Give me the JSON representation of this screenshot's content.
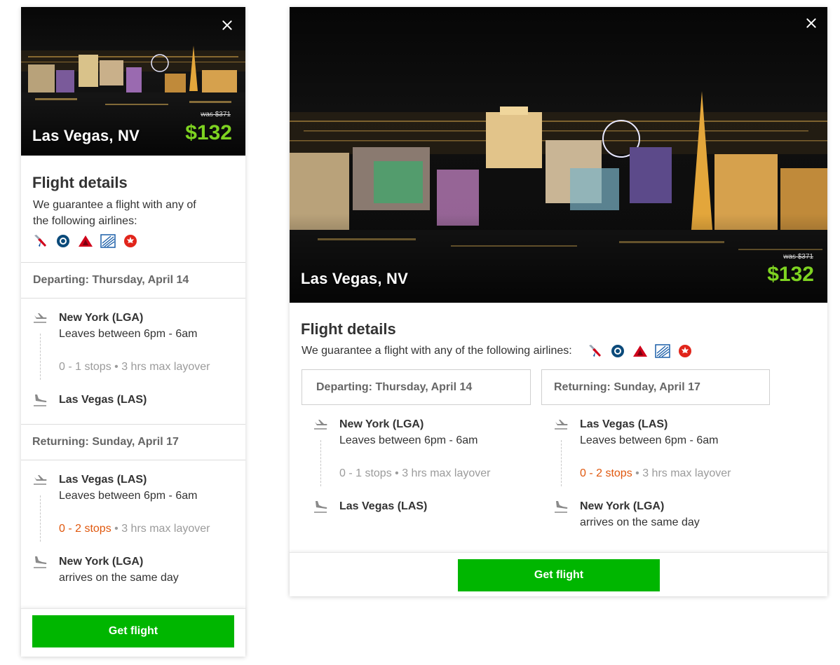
{
  "trip": {
    "city": "Las Vegas, NV",
    "was_price": "was $371",
    "price": "$132"
  },
  "details": {
    "title": "Flight details",
    "guarantee": "We guarantee a flight with any of the following airlines:",
    "airlines": [
      "american-airlines-icon",
      "alaska-airlines-icon",
      "delta-icon",
      "united-icon",
      "air-canada-icon"
    ]
  },
  "departing": {
    "header": "Departing: Thursday, April 14",
    "from": "New York (LGA)",
    "leaves": "Leaves between 6pm - 6am",
    "stops": "0 - 1 stops",
    "stops_highlighted": false,
    "layover": "• 3 hrs max layover",
    "to": "Las Vegas (LAS)",
    "arrives": ""
  },
  "returning": {
    "header": "Returning: Sunday, April 17",
    "from": "Las Vegas (LAS)",
    "leaves": "Leaves between 6pm - 6am",
    "stops": "0 - 2 stops",
    "stops_highlighted": true,
    "layover": "• 3 hrs max layover",
    "to": "New York (LGA)",
    "arrives": "arrives on the same day"
  },
  "cta": {
    "label": "Get flight"
  },
  "colors": {
    "price": "#7ed321",
    "cta": "#00b600",
    "stops_warning": "#e0580e"
  }
}
